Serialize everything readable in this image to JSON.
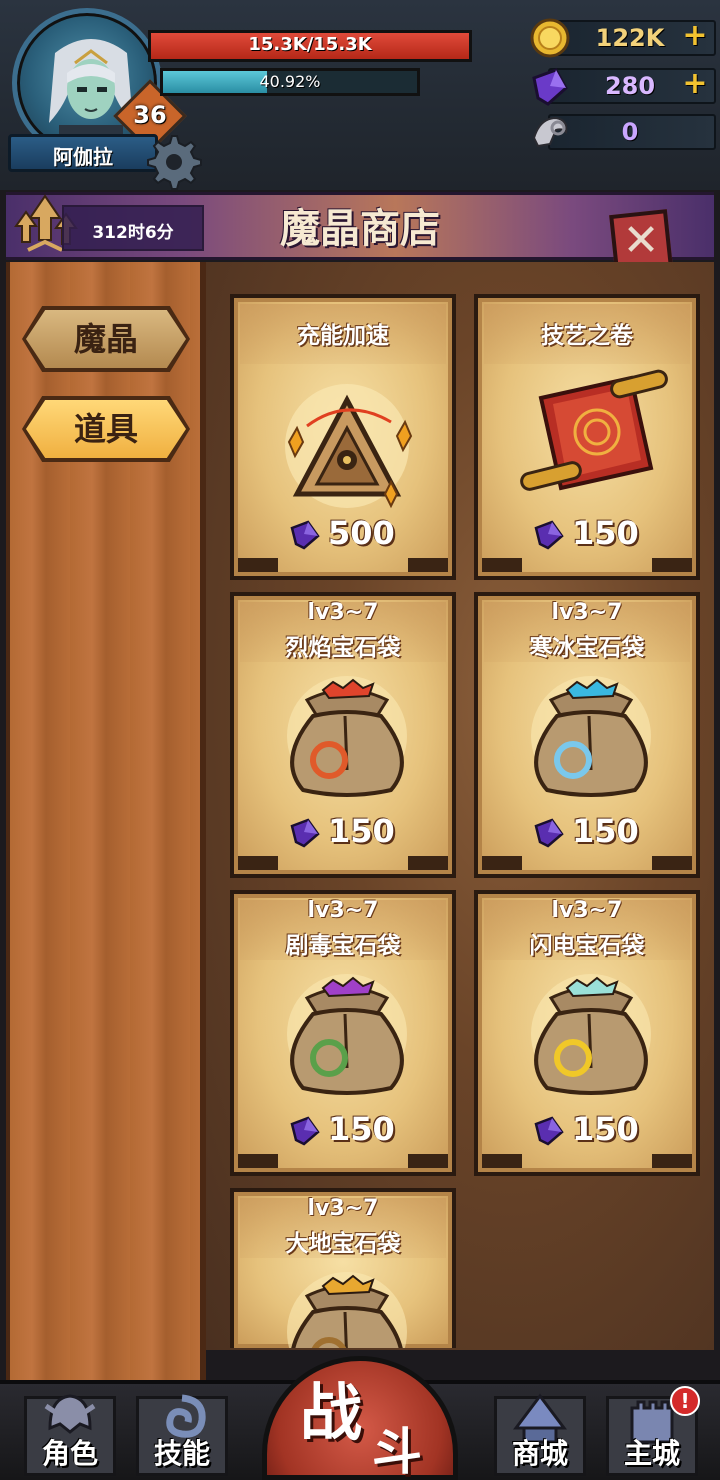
{
  "player": {
    "name": "阿伽拉",
    "level": "36",
    "hp_text": "15.3K/15.3K",
    "hp_fraction": 1.0,
    "xp_text": "40.92%",
    "xp_fraction": 0.4092
  },
  "resources": [
    {
      "icon": "gold-coin-icon",
      "value": "122K",
      "color": "#f3d27a",
      "plus": "+"
    },
    {
      "icon": "purple-crystal-icon",
      "value": "280",
      "color": "#d9b8ff",
      "plus": "+"
    },
    {
      "icon": "ram-skull-icon",
      "value": "0",
      "color": "#c9a6ff",
      "plus": ""
    }
  ],
  "shop": {
    "title": "魔晶商店",
    "timer": "312时6分",
    "close_icon": "close-icon"
  },
  "tabs": [
    {
      "label": "魔晶",
      "active": false
    },
    {
      "label": "道具",
      "active": true
    }
  ],
  "items": [
    {
      "sub": "",
      "name": "充能加速",
      "price": "500",
      "art": "charge-accelerator-icon"
    },
    {
      "sub": "",
      "name": "技艺之卷",
      "price": "150",
      "art": "skill-scroll-icon"
    },
    {
      "sub": "lv3~7",
      "name": "烈焰宝石袋",
      "price": "150",
      "art": "fire-gem-bag-icon",
      "gem": "#e0442c",
      "sigil": "#e05a2a"
    },
    {
      "sub": "lv3~7",
      "name": "寒冰宝石袋",
      "price": "150",
      "art": "ice-gem-bag-icon",
      "gem": "#3ab8e0",
      "sigil": "#7ac8ec"
    },
    {
      "sub": "lv3~7",
      "name": "剧毒宝石袋",
      "price": "150",
      "art": "poison-gem-bag-icon",
      "gem": "#a040c8",
      "sigil": "#5aa04a"
    },
    {
      "sub": "lv3~7",
      "name": "闪电宝石袋",
      "price": "150",
      "art": "lightning-gem-bag-icon",
      "gem": "#9ae0d8",
      "sigil": "#f0c828"
    },
    {
      "sub": "lv3~7",
      "name": "大地宝石袋",
      "price": "",
      "art": "earth-gem-bag-icon",
      "gem": "#e8a830",
      "sigil": "#a07030"
    }
  ],
  "nav": {
    "role": "角色",
    "skill": "技能",
    "battle_1": "战",
    "battle_2": "斗",
    "mall": "商城",
    "city": "主城",
    "city_badge": "!"
  }
}
